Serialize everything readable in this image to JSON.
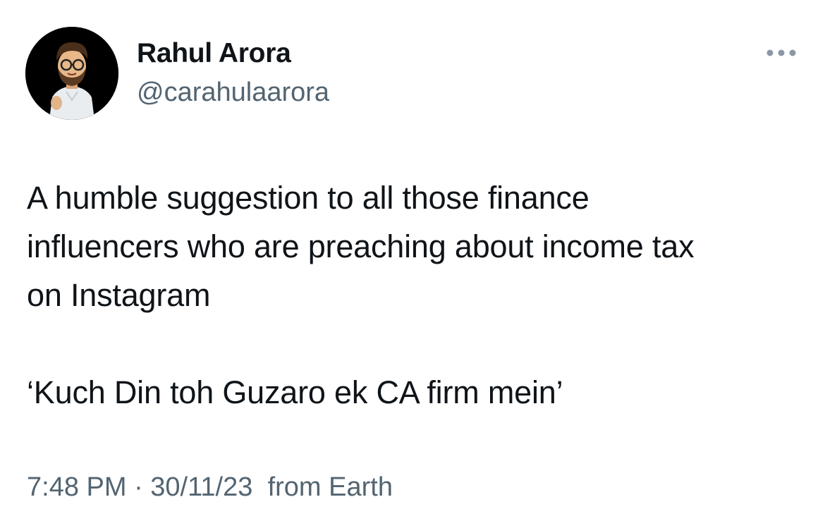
{
  "tweet": {
    "author": {
      "name": "Rahul Arora",
      "handle": "@carahulaarora"
    },
    "more_icon": "more-horizontal-icon",
    "text_lines": [
      "A humble suggestion to all those finance\ninfluencers who are preaching about income tax\non Instagram",
      "‘Kuch Din toh Guzaro ek CA firm mein’"
    ],
    "timestamp": "7:48 PM · 30/11/23",
    "source": "from Earth"
  },
  "colors": {
    "text": "#0f1419",
    "secondary": "#536471",
    "background": "#ffffff"
  }
}
